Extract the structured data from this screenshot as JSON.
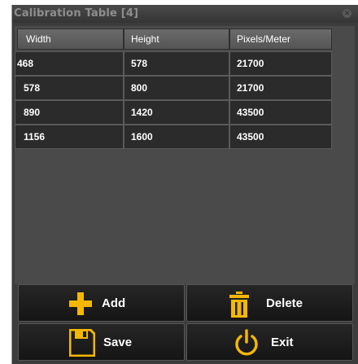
{
  "window": {
    "title": "Calibration Table [4]"
  },
  "table": {
    "headers": [
      "Width",
      "Height",
      "Pixels/Meter"
    ],
    "rows": [
      [
        "468",
        "578",
        "21700"
      ],
      [
        "578",
        "800",
        "21700"
      ],
      [
        "890",
        "1420",
        "43500"
      ],
      [
        "1156",
        "1600",
        "43500"
      ]
    ]
  },
  "buttons": {
    "add": {
      "label": "Add",
      "icon": "plus-icon",
      "color": "#f5b800"
    },
    "delete": {
      "label": "Delete",
      "icon": "trash-icon",
      "color": "#f5b800"
    },
    "save": {
      "label": "Save",
      "icon": "floppy-disk-icon",
      "color": "#f5b800"
    },
    "exit": {
      "label": "Exit",
      "icon": "power-icon",
      "color": "#f5b800"
    }
  },
  "colors": {
    "accent": "#f5b800",
    "background": "#3c3c3c",
    "cell": "#2b2b2b"
  }
}
